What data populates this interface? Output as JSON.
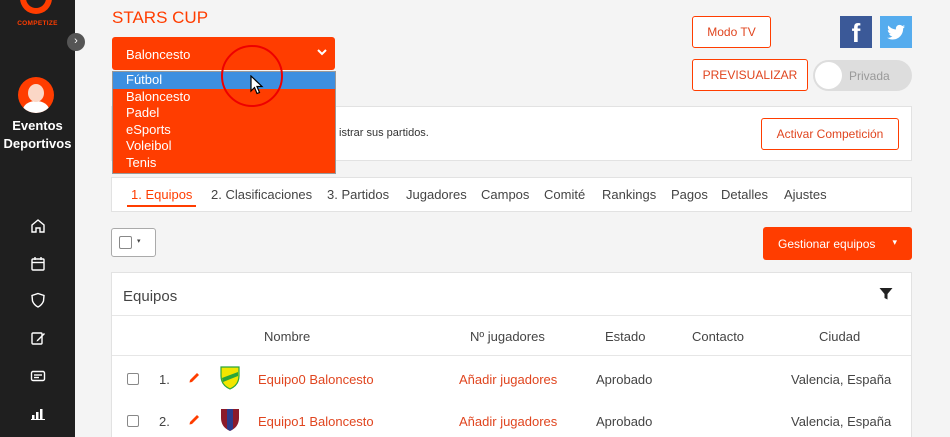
{
  "logo": {
    "text": "COMPETIZE"
  },
  "sidebar": {
    "title_line1": "Eventos",
    "title_line2": "Deportivos",
    "collapse_glyph": "›",
    "nav_icons": [
      "home-icon",
      "calendar-icon",
      "shield-icon",
      "edit-icon",
      "id-card-icon",
      "bar-chart-icon"
    ]
  },
  "page": {
    "title": "STARS CUP",
    "sport_select": {
      "value": "Baloncesto",
      "options": [
        "Fútbol",
        "Baloncesto",
        "Padel",
        "eSports",
        "Voleibol",
        "Tenis"
      ],
      "highlighted": "Fútbol"
    },
    "modo_tv": "Modo TV",
    "previsualizar": "PREVISUALIZAR",
    "privada": "Privada",
    "facebook_glyph": "f",
    "twitter_glyph": "t"
  },
  "notice": {
    "text": "istrar sus partidos.",
    "button": "Activar Competición"
  },
  "tabs": [
    "1. Equipos",
    "2. Clasificaciones",
    "3. Partidos",
    "Jugadores",
    "Campos",
    "Comité",
    "Rankings",
    "Pagos",
    "Detalles",
    "Ajustes"
  ],
  "toolbar": {
    "manage_button": "Gestionar equipos",
    "manage_caret": "▾",
    "select_caret": "▾"
  },
  "teams_panel": {
    "title": "Equipos",
    "columns": [
      "Nombre",
      "Nº jugadores",
      "Estado",
      "Contacto",
      "Ciudad"
    ],
    "rows": [
      {
        "num": "1.",
        "name": "Equipo0 Baloncesto",
        "players": "Añadir jugadores",
        "estado": "Aprobado",
        "contacto": "",
        "ciudad": "Valencia, España",
        "shield_colors": [
          "#f2e600",
          "#2aa63a"
        ]
      },
      {
        "num": "2.",
        "name": "Equipo1 Baloncesto",
        "players": "Añadir jugadores",
        "estado": "Aprobado",
        "contacto": "",
        "ciudad": "Valencia, España",
        "shield_colors": [
          "#8b1a2b",
          "#2b3a8b"
        ]
      }
    ]
  },
  "colors": {
    "accent": "#ff3d00",
    "sidebar": "#1f1f1f",
    "highlight": "#3d8fe0",
    "facebook": "#3b5998",
    "twitter": "#55acee"
  }
}
